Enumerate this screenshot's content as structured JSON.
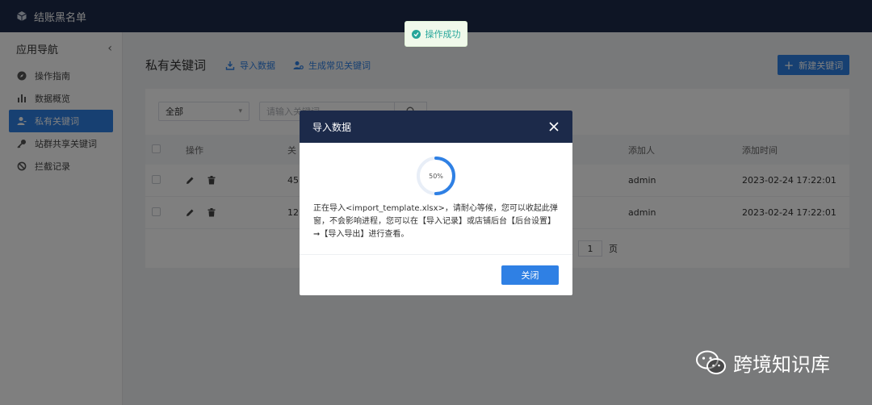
{
  "app": {
    "title": "结账黑名单"
  },
  "sidebar": {
    "header": "应用导航",
    "items": [
      {
        "label": "操作指南",
        "icon": "compass-icon"
      },
      {
        "label": "数据概览",
        "icon": "bar-chart-icon"
      },
      {
        "label": "私有关键词",
        "icon": "user-key-icon",
        "active": true
      },
      {
        "label": "站群共享关键词",
        "icon": "key-icon"
      },
      {
        "label": "拦截记录",
        "icon": "block-icon"
      }
    ]
  },
  "page": {
    "title": "私有关键词",
    "import_link": "导入数据",
    "generate_link": "生成常见关键词",
    "new_button": "新建关键词"
  },
  "filter": {
    "select_value": "全部",
    "search_placeholder": "请输入关键词"
  },
  "table": {
    "columns": [
      "操作",
      "关",
      "添加人",
      "添加时间"
    ],
    "rows": [
      {
        "keyword": "45",
        "adder": "admin",
        "time": "2023-02-24 17:22:01"
      },
      {
        "keyword": "12",
        "adder": "admin",
        "time": "2023-02-24 17:22:01"
      }
    ]
  },
  "pagination": {
    "current": "1",
    "suffix": "页"
  },
  "toast": {
    "text": "操作成功"
  },
  "modal": {
    "title": "导入数据",
    "progress_label": "50%",
    "progress_value": 0.5,
    "message": "正在导入<import_template.xlsx>，请耐心等候，您可以收起此弹窗，不会影响进程，您可以在【导入记录】或店铺后台【后台设置】➞【导入导出】进行查看。",
    "close_button": "关闭"
  },
  "watermark": {
    "text": "跨境知识库"
  },
  "colors": {
    "topbar": "#1c2a4a",
    "accent": "#2f80e4",
    "success": "#26a69a"
  }
}
